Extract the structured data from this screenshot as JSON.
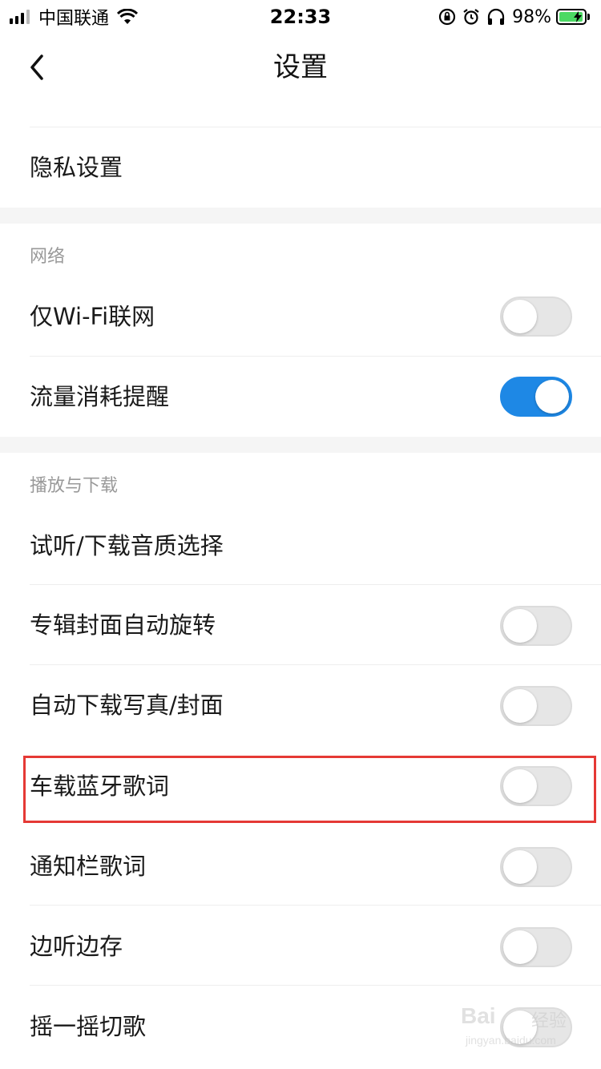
{
  "status_bar": {
    "carrier": "中国联通",
    "time": "22:33",
    "battery_percent": "98%",
    "battery_level": 0.98,
    "icons": [
      "signal-icon",
      "wifi-icon",
      "orientation-lock-icon",
      "alarm-icon",
      "headphones-icon",
      "battery-icon"
    ]
  },
  "nav": {
    "title": "设置",
    "back_icon": "chevron-left-icon"
  },
  "rows": {
    "privacy": "隐私设置"
  },
  "sections": {
    "network": {
      "header": "网络",
      "items": [
        {
          "label": "仅Wi-Fi联网",
          "toggle": false
        },
        {
          "label": "流量消耗提醒",
          "toggle": true
        }
      ]
    },
    "playback": {
      "header": "播放与下载",
      "items": [
        {
          "label": "试听/下载音质选择"
        },
        {
          "label": "专辑封面自动旋转",
          "toggle": false
        },
        {
          "label": "自动下载写真/封面",
          "toggle": false
        },
        {
          "label": "车载蓝牙歌词",
          "toggle": false,
          "highlighted": true
        },
        {
          "label": "通知栏歌词",
          "toggle": false
        },
        {
          "label": "边听边存",
          "toggle": false
        },
        {
          "label": "摇一摇切歌",
          "toggle": false
        }
      ]
    }
  },
  "colors": {
    "toggle_on": "#1e88e5",
    "toggle_off": "#e6e6e6",
    "highlight": "#e53935",
    "section_bg": "#f5f5f5",
    "battery_fill": "#4cd964"
  },
  "watermark": {
    "brand": "Bai",
    "brand_cn": "经验",
    "url": "jingyan.baidu.com"
  }
}
